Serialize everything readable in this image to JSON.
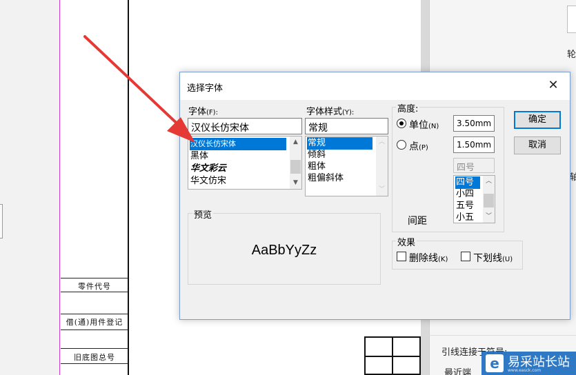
{
  "background": {
    "cell_labels": [
      "零件代号",
      "借(通)用件登记",
      "旧底图总号"
    ]
  },
  "right_panel": {
    "fragment_top": "轮",
    "fragment_mid": "轴",
    "fragment_label": "引线连接于符号:",
    "fragment_bottom": "最近端"
  },
  "watermark": {
    "logo": "e",
    "text": "易采站长站",
    "subtext": "www.easck.com"
  },
  "dialog": {
    "title": "选择字体",
    "close_icon": "close-icon",
    "font": {
      "label": "字体",
      "hotkey": "(F):",
      "value": "汉仪长仿宋体",
      "items": [
        "汉仪长仿宋体",
        "黑体",
        "华文彩云",
        "华文仿宋"
      ]
    },
    "style": {
      "label": "字体样式",
      "hotkey": "(Y):",
      "value": "常规",
      "items": [
        "常规",
        "倾斜",
        "粗体",
        "粗偏斜体"
      ]
    },
    "height": {
      "label": "高度:",
      "unit_label": "单位",
      "unit_hotkey": "(N)",
      "unit_value": "3.50mm",
      "point_label": "点",
      "point_hotkey": "(P)",
      "point_value": "1.50mm",
      "size_value": "四号",
      "size_items": [
        "四号",
        "小四",
        "五号",
        "小五"
      ],
      "spacing_label": "间距"
    },
    "preview": {
      "label": "预览",
      "sample": "AaBbYyZz"
    },
    "effects": {
      "label": "效果",
      "strikethrough_label": "删除线",
      "strikethrough_hotkey": "(K)",
      "underline_label": "下划线",
      "underline_hotkey": "(U)"
    },
    "buttons": {
      "ok": "确定",
      "cancel": "取消"
    }
  },
  "colors": {
    "selection": "#0078d7",
    "arrow": "#e53935",
    "watermark": "#1f6fc0"
  }
}
